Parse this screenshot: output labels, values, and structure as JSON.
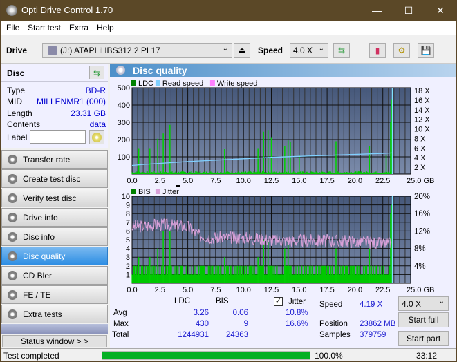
{
  "window": {
    "title": "Opti Drive Control 1.70",
    "minimize": "—",
    "maximize": "☐",
    "close": "✕"
  },
  "menu": [
    "File",
    "Start test",
    "Extra",
    "Help"
  ],
  "toolbar": {
    "drive_label": "Drive",
    "drive_value": "(J:)  ATAPI iHBS312  2 PL17",
    "speed_label": "Speed",
    "speed_value": "4.0 X"
  },
  "disc": {
    "header": "Disc",
    "rows": [
      {
        "k": "Type",
        "v": "BD-R"
      },
      {
        "k": "MID",
        "v": "MILLENMR1 (000)"
      },
      {
        "k": "Length",
        "v": "23.31 GB"
      },
      {
        "k": "Contents",
        "v": "data"
      }
    ],
    "label_label": "Label",
    "label_value": ""
  },
  "nav": [
    "Transfer rate",
    "Create test disc",
    "Verify test disc",
    "Drive info",
    "Disc info",
    "Disc quality",
    "CD Bler",
    "FE / TE",
    "Extra tests"
  ],
  "nav_active": 5,
  "status_window_label": "Status window > >",
  "panel_title": "Disc quality",
  "chart_data": [
    {
      "type": "bar",
      "title": "LDC",
      "legend": [
        "LDC",
        "Read speed",
        "Write speed"
      ],
      "colors": {
        "LDC": "#00c800",
        "Read speed": "#80d0ff",
        "Write speed": "#ff80ff"
      },
      "xlabel": "GB",
      "xlim": [
        0,
        25
      ],
      "x_ticks": [
        "0.0",
        "2.5",
        "5.0",
        "7.5",
        "10.0",
        "12.5",
        "15.0",
        "17.5",
        "20.0",
        "22.5",
        "25.0 GB"
      ],
      "ylim": [
        0,
        500
      ],
      "y_ticks": [
        "500",
        "400",
        "300",
        "200",
        "100"
      ],
      "y2_ticks": [
        "18 X",
        "16 X",
        "14 X",
        "12 X",
        "10 X",
        "8 X",
        "6 X",
        "4 X",
        "2 X"
      ],
      "y2lim": [
        0,
        18
      ],
      "ldc_peaks": [
        [
          0.6,
          150
        ],
        [
          1.6,
          150
        ],
        [
          2.3,
          205
        ],
        [
          2.8,
          235
        ],
        [
          3.4,
          285
        ],
        [
          8.3,
          145
        ],
        [
          11.3,
          150
        ],
        [
          11.8,
          245
        ],
        [
          12.2,
          255
        ],
        [
          12.5,
          210
        ],
        [
          13.7,
          160
        ],
        [
          14.0,
          195
        ],
        [
          14.2,
          185
        ],
        [
          15.0,
          110
        ],
        [
          18.3,
          190
        ],
        [
          21.3,
          160
        ],
        [
          22.8,
          110
        ],
        [
          23.2,
          300
        ],
        [
          23.3,
          430
        ]
      ],
      "read_speed": [
        [
          0,
          1.8
        ],
        [
          1,
          2.0
        ],
        [
          3,
          2.3
        ],
        [
          5,
          2.6
        ],
        [
          7.5,
          2.9
        ],
        [
          10,
          3.2
        ],
        [
          12.5,
          3.5
        ],
        [
          15,
          3.7
        ],
        [
          17.5,
          3.9
        ],
        [
          20,
          4.1
        ],
        [
          22.5,
          4.3
        ],
        [
          23.3,
          4.4
        ]
      ]
    },
    {
      "type": "bar",
      "title": "BIS",
      "legend": [
        "BIS",
        "Jitter"
      ],
      "colors": {
        "BIS": "#00c800",
        "Jitter": "#d8a0d8"
      },
      "xlabel": "GB",
      "xlim": [
        0,
        25
      ],
      "x_ticks": [
        "0.0",
        "2.5",
        "5.0",
        "7.5",
        "10.0",
        "12.5",
        "15.0",
        "17.5",
        "20.0",
        "22.5",
        "25.0 GB"
      ],
      "ylim": [
        0,
        10
      ],
      "y_ticks": [
        "10",
        "9",
        "8",
        "7",
        "6",
        "5",
        "4",
        "3",
        "2",
        "1"
      ],
      "y2_ticks": [
        "20%",
        "16%",
        "12%",
        "8%",
        "4%"
      ],
      "y2lim": [
        0,
        20
      ],
      "bis_peaks": [
        [
          0.6,
          3
        ],
        [
          1.6,
          3
        ],
        [
          2.3,
          4
        ],
        [
          2.8,
          6
        ],
        [
          3.4,
          6
        ],
        [
          8.3,
          3
        ],
        [
          11.3,
          3
        ],
        [
          11.8,
          5
        ],
        [
          12.2,
          5
        ],
        [
          13.7,
          4
        ],
        [
          14.0,
          5
        ],
        [
          18.3,
          4
        ],
        [
          21.3,
          4
        ],
        [
          23.2,
          8
        ],
        [
          23.3,
          9
        ]
      ],
      "jitter_pct": [
        [
          0,
          13
        ],
        [
          2.5,
          13.5
        ],
        [
          5,
          13
        ],
        [
          6,
          11
        ],
        [
          7.5,
          10.5
        ],
        [
          10,
          10.5
        ],
        [
          12.5,
          10
        ],
        [
          15,
          9.8
        ],
        [
          17.5,
          9.8
        ],
        [
          20,
          9.6
        ],
        [
          22.5,
          9.2
        ],
        [
          23.3,
          9
        ]
      ]
    }
  ],
  "stats": {
    "col_ldc": "LDC",
    "col_bis": "BIS",
    "avg_label": "Avg",
    "max_label": "Max",
    "total_label": "Total",
    "avg_ldc": "3.26",
    "avg_bis": "0.06",
    "max_ldc": "430",
    "max_bis": "9",
    "total_ldc": "1244931",
    "total_bis": "24363",
    "jitter_label": "Jitter",
    "jitter_checked": true,
    "jitter_avg": "10.8%",
    "jitter_max": "16.6%",
    "speed_label": "Speed",
    "speed_value": "4.19 X",
    "position_label": "Position",
    "position_value": "23862 MB",
    "samples_label": "Samples",
    "samples_value": "379759",
    "speed_select": "4.0 X",
    "start_full": "Start full",
    "start_part": "Start part"
  },
  "status": {
    "text": "Test completed",
    "progress_pct": 100,
    "progress_label": "100.0%",
    "time": "33:12"
  }
}
